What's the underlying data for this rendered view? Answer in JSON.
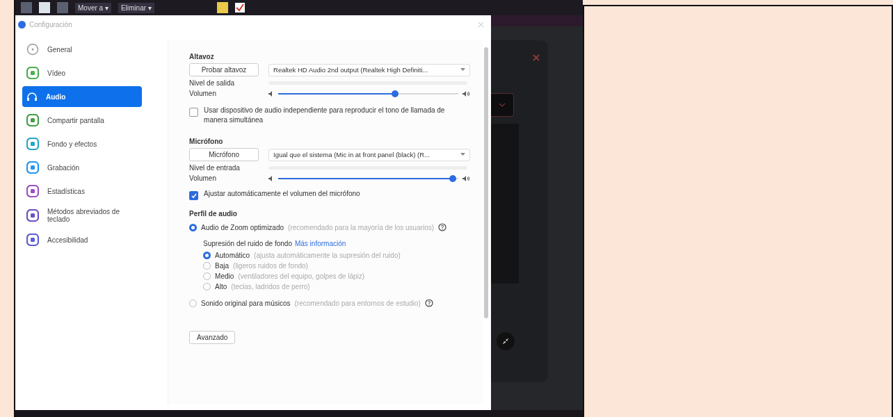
{
  "taskbar": {
    "items": [
      {
        "label": "Mover a ▾"
      },
      {
        "label": "Eliminar ▾"
      }
    ]
  },
  "dialog": {
    "title": "Configuración",
    "sidebar": {
      "items": [
        {
          "label": "General",
          "kind": "circle",
          "color": "#9a9a9a",
          "selected": false
        },
        {
          "label": "Vídeo",
          "kind": "tile",
          "color": "#4caf50",
          "selected": false
        },
        {
          "label": "Audio",
          "kind": "headphones",
          "color": "#ffffff",
          "selected": true
        },
        {
          "label": "Compartir pantalla",
          "kind": "tile",
          "color": "#43a047",
          "selected": false
        },
        {
          "label": "Fondo y efectos",
          "kind": "tile",
          "color": "#26a6c9",
          "selected": false
        },
        {
          "label": "Grabación",
          "kind": "tile",
          "color": "#2196f3",
          "selected": false
        },
        {
          "label": "Estadísticas",
          "kind": "tile",
          "color": "#9c4fc4",
          "selected": false
        },
        {
          "label": "Métodos abreviados de teclado",
          "kind": "tile",
          "color": "#6a4fc4",
          "selected": false
        },
        {
          "label": "Accesibilidad",
          "kind": "tile",
          "color": "#5b5fd6",
          "selected": false
        }
      ]
    },
    "speaker": {
      "heading": "Altavoz",
      "test_button": "Probar altavoz",
      "device": "Realtek HD Audio 2nd output (Realtek High Definiti...",
      "level_label": "Nivel de salida",
      "volume_label": "Volumen",
      "volume": {
        "level": 0.65
      }
    },
    "ringtone_checkbox": {
      "label": "Usar dispositivo de audio independiente para reproducir el tono de llamada de manera simultánea",
      "checked": false
    },
    "microphone": {
      "heading": "Micrófono",
      "test_button": "Micrófono",
      "device": "Igual que el sistema (Mic in at front panel (black) (R...",
      "level_label": "Nivel de entrada",
      "volume_label": "Volumen",
      "volume": {
        "level": 0.97
      }
    },
    "auto_volume_checkbox": {
      "label": "Ajustar automáticamente el volumen del micrófono",
      "checked": true
    },
    "profile": {
      "heading": "Perfil de audio",
      "optimized": {
        "label": "Audio de Zoom optimizado",
        "note": "(recomendado para la mayoría de los usuarios)",
        "selected": true
      },
      "noise": {
        "label": "Supresión del ruido de fondo",
        "link": "Más información",
        "options": [
          {
            "label": "Automático",
            "note": "(ajusta automáticamente la supresión del ruido)",
            "selected": true
          },
          {
            "label": "Baja",
            "note": "(ligeros ruidos de fondo)",
            "selected": false
          },
          {
            "label": "Medio",
            "note": "(ventiladores del equipo, golpes de lápiz)",
            "selected": false
          },
          {
            "label": "Alto",
            "note": "(teclas, ladridos de perro)",
            "selected": false
          }
        ]
      },
      "original": {
        "label": "Sonido original para músicos",
        "note": "(recomendado para entornos de estudio)",
        "selected": false
      }
    },
    "advanced_button": "Avanzado"
  }
}
